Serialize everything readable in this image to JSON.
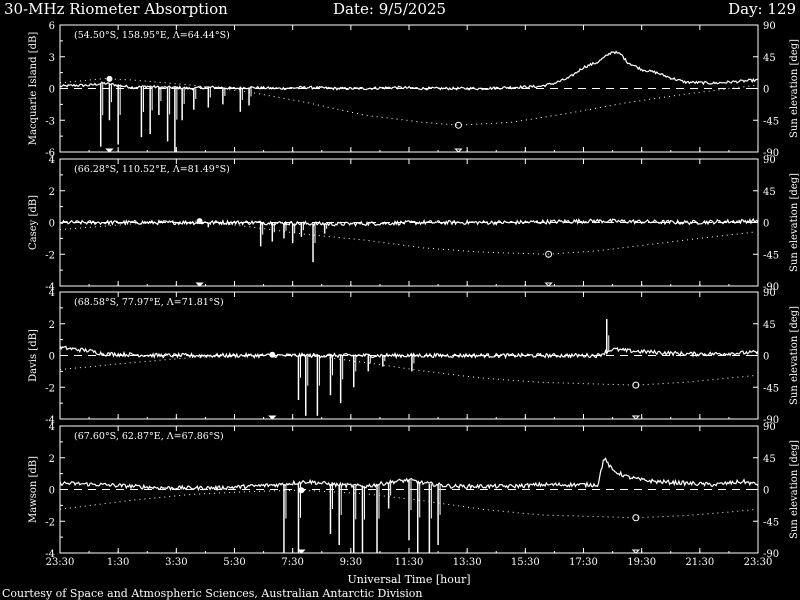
{
  "header": {
    "title": "30-MHz Riometer Absorption",
    "date": "Date: 9/5/2025",
    "day": "Day: 129"
  },
  "footer": {
    "credit": "Courtesy of Space and Atmospheric Sciences, Australian Antarctic Division"
  },
  "colors": {
    "background": "#000000",
    "foreground": "#ffffff"
  },
  "chart_data": {
    "type": "line",
    "xlabel": "Universal Time [hour]",
    "x_tick_labels": [
      "23:30",
      "1:30",
      "3:30",
      "5:30",
      "7:30",
      "9:30",
      "11:30",
      "13:30",
      "15:30",
      "17:30",
      "19:30",
      "21:30",
      "23:30"
    ],
    "x_range_hours": [
      -0.5,
      23.5
    ],
    "right_axis_label": "Sun elevation [deg]",
    "right_axis_ticks": [
      "90",
      "45",
      "0",
      "-45",
      "-90"
    ],
    "right_axis_range": [
      -90,
      90
    ],
    "panels": [
      {
        "station": "Macquarie Island",
        "ylabel": "Macquarie Island [dB]",
        "coords": "(54.50°S, 158.95°E, Λ=64.44°S)",
        "ylim": [
          -6,
          6
        ],
        "y_ticks": [
          "6",
          "3",
          "0",
          "-3",
          "-6"
        ],
        "absorption": [
          [
            -0.5,
            0.2
          ],
          [
            0,
            0.3
          ],
          [
            0.5,
            0.3
          ],
          [
            1,
            0.5
          ],
          [
            1.5,
            0.3
          ],
          [
            2,
            0.1
          ],
          [
            2.5,
            0.2
          ],
          [
            3,
            0.1
          ],
          [
            3.5,
            0.1
          ],
          [
            4,
            0.0
          ],
          [
            4.5,
            0.1
          ],
          [
            5,
            0.1
          ],
          [
            5.5,
            0.0
          ],
          [
            6,
            0.1
          ],
          [
            7,
            0.0
          ],
          [
            8,
            0.1
          ],
          [
            9,
            0.0
          ],
          [
            10,
            0.0
          ],
          [
            11,
            0.1
          ],
          [
            12,
            0.0
          ],
          [
            13,
            0.0
          ],
          [
            14,
            0.0
          ],
          [
            15,
            0.1
          ],
          [
            16,
            0.2
          ],
          [
            16.5,
            0.5
          ],
          [
            17,
            1.0
          ],
          [
            17.5,
            2.0
          ],
          [
            18,
            2.5
          ],
          [
            18.5,
            3.5
          ],
          [
            18.8,
            3.2
          ],
          [
            19,
            2.5
          ],
          [
            19.5,
            1.8
          ],
          [
            20,
            1.5
          ],
          [
            20.5,
            1.0
          ],
          [
            21,
            0.6
          ],
          [
            22,
            0.5
          ],
          [
            23,
            0.7
          ],
          [
            23.5,
            0.8
          ]
        ],
        "spikes": [
          [
            0.9,
            -5.5
          ],
          [
            1.2,
            -3.0
          ],
          [
            1.5,
            -5.3
          ],
          [
            2.3,
            -4.6
          ],
          [
            2.6,
            -4.3
          ],
          [
            2.9,
            -2.5
          ],
          [
            3.2,
            -5.0
          ],
          [
            3.45,
            -6.0
          ],
          [
            3.7,
            -3.0
          ],
          [
            4.1,
            -2.0
          ],
          [
            4.6,
            -1.8
          ],
          [
            5.1,
            -1.5
          ],
          [
            5.7,
            -2.2
          ],
          [
            6.0,
            -1.6
          ]
        ],
        "sun_elevation": [
          [
            -0.5,
            8
          ],
          [
            1.0,
            14
          ],
          [
            2.0,
            12
          ],
          [
            4.0,
            5
          ],
          [
            6.0,
            -5
          ],
          [
            8.0,
            -20
          ],
          [
            10.0,
            -38
          ],
          [
            12.0,
            -48
          ],
          [
            13.2,
            -52
          ],
          [
            15.0,
            -48
          ],
          [
            17.0,
            -35
          ],
          [
            19.0,
            -20
          ],
          [
            21.0,
            -8
          ],
          [
            23.5,
            5
          ]
        ],
        "sun_max_hour": 1.2,
        "sun_min_hour": 13.2
      },
      {
        "station": "Casey",
        "ylabel": "Casey [dB]",
        "coords": "(66.28°S, 110.52°E, Λ=81.49°S)",
        "ylim": [
          -4,
          4
        ],
        "y_ticks": [
          "4",
          "2",
          "0",
          "-2",
          "-4"
        ],
        "absorption": [
          [
            -0.5,
            0.0
          ],
          [
            3,
            0.0
          ],
          [
            6,
            0.0
          ],
          [
            9,
            -0.1
          ],
          [
            12,
            0.0
          ],
          [
            15,
            0.0
          ],
          [
            18,
            0.1
          ],
          [
            21,
            0.0
          ],
          [
            23.5,
            0.1
          ]
        ],
        "spikes": [
          [
            4.6,
            -0.3
          ],
          [
            6.4,
            -1.5
          ],
          [
            6.8,
            -1.2
          ],
          [
            7.2,
            -1.0
          ],
          [
            7.5,
            -1.3
          ],
          [
            7.8,
            -0.9
          ],
          [
            8.2,
            -2.5
          ],
          [
            8.6,
            -0.7
          ]
        ],
        "sun_elevation": [
          [
            -0.5,
            -10
          ],
          [
            2.0,
            -2
          ],
          [
            4.3,
            2
          ],
          [
            6.0,
            -6
          ],
          [
            8.0,
            -17
          ],
          [
            10.0,
            -25
          ],
          [
            12.0,
            -36
          ],
          [
            14.0,
            -42
          ],
          [
            16.3,
            -45
          ],
          [
            18.0,
            -40
          ],
          [
            20.0,
            -30
          ],
          [
            22.0,
            -20
          ],
          [
            23.5,
            -13
          ]
        ],
        "sun_max_hour": 4.3,
        "sun_min_hour": 16.3
      },
      {
        "station": "Davis",
        "ylabel": "Davis [dB]",
        "coords": "(68.58°S, 77.97°E, Λ=71.81°S)",
        "ylim": [
          -4,
          4
        ],
        "y_ticks": [
          "4",
          "2",
          "0",
          "-2",
          "-4"
        ],
        "absorption": [
          [
            -0.5,
            0.5
          ],
          [
            0.5,
            0.3
          ],
          [
            1,
            0.1
          ],
          [
            3,
            0.0
          ],
          [
            6,
            0.0
          ],
          [
            9,
            0.0
          ],
          [
            12,
            0.0
          ],
          [
            15,
            0.0
          ],
          [
            18,
            0.0
          ],
          [
            18.5,
            0.4
          ],
          [
            19,
            0.3
          ],
          [
            20,
            0.2
          ],
          [
            21,
            0.1
          ],
          [
            22,
            0.1
          ],
          [
            23.5,
            0.2
          ]
        ],
        "spikes": [
          [
            7.7,
            -2.8
          ],
          [
            7.95,
            -3.8
          ],
          [
            8.35,
            -3.8
          ],
          [
            8.8,
            -2.5
          ],
          [
            9.15,
            -3.0
          ],
          [
            9.6,
            -2.0
          ],
          [
            10.1,
            -1.0
          ],
          [
            10.6,
            -0.7
          ],
          [
            11.6,
            -1.0
          ],
          [
            18.3,
            2.3
          ]
        ],
        "sun_elevation": [
          [
            -0.5,
            -20
          ],
          [
            2.0,
            -10
          ],
          [
            4.0,
            -3
          ],
          [
            6.8,
            1
          ],
          [
            8.5,
            -2
          ],
          [
            10.0,
            -10
          ],
          [
            12.0,
            -22
          ],
          [
            14.0,
            -32
          ],
          [
            16.0,
            -38
          ],
          [
            19.3,
            -42
          ],
          [
            21.0,
            -38
          ],
          [
            22.5,
            -32
          ],
          [
            23.5,
            -28
          ]
        ],
        "sun_max_hour": 6.8,
        "sun_min_hour": 19.3
      },
      {
        "station": "Mawson",
        "ylabel": "Mawson [dB]",
        "coords": "(67.60°S, 62.87°E, Λ=67.86°S)",
        "ylim": [
          -4,
          4
        ],
        "y_ticks": [
          "4",
          "2",
          "0",
          "-2",
          "-4"
        ],
        "absorption": [
          [
            -0.5,
            0.4
          ],
          [
            1,
            0.3
          ],
          [
            2,
            0.2
          ],
          [
            3,
            0.1
          ],
          [
            5,
            0.1
          ],
          [
            7,
            0.3
          ],
          [
            8,
            0.5
          ],
          [
            9,
            0.3
          ],
          [
            10,
            0.2
          ],
          [
            11,
            0.5
          ],
          [
            11.5,
            0.6
          ],
          [
            12,
            0.4
          ],
          [
            13,
            0.2
          ],
          [
            14,
            0.2
          ],
          [
            15,
            0.2
          ],
          [
            16,
            0.3
          ],
          [
            17,
            0.3
          ],
          [
            18,
            0.3
          ],
          [
            18.2,
            2.0
          ],
          [
            18.5,
            1.2
          ],
          [
            19,
            0.8
          ],
          [
            19.5,
            0.6
          ],
          [
            20,
            0.5
          ],
          [
            21,
            0.4
          ],
          [
            22,
            0.3
          ],
          [
            23,
            0.5
          ],
          [
            23.5,
            0.3
          ]
        ],
        "spikes": [
          [
            7.2,
            -4.0
          ],
          [
            7.7,
            -4.0
          ],
          [
            8.8,
            -2.8
          ],
          [
            9.1,
            -3.5
          ],
          [
            9.6,
            -4.0
          ],
          [
            9.9,
            -4.0
          ],
          [
            10.4,
            -4.0
          ],
          [
            10.8,
            -1.2
          ],
          [
            11.5,
            -3.2
          ],
          [
            11.8,
            -4.0
          ],
          [
            12.2,
            -4.0
          ],
          [
            12.5,
            -3.5
          ]
        ],
        "sun_elevation": [
          [
            -0.5,
            -28
          ],
          [
            2.0,
            -15
          ],
          [
            4.0,
            -7
          ],
          [
            6.0,
            -3
          ],
          [
            7.8,
            -1
          ],
          [
            10.0,
            -6
          ],
          [
            12.0,
            -16
          ],
          [
            14.0,
            -28
          ],
          [
            16.0,
            -36
          ],
          [
            19.3,
            -40
          ],
          [
            21.0,
            -37
          ],
          [
            22.5,
            -32
          ],
          [
            23.5,
            -28
          ]
        ],
        "sun_max_hour": 7.8,
        "sun_min_hour": 19.3
      }
    ]
  }
}
